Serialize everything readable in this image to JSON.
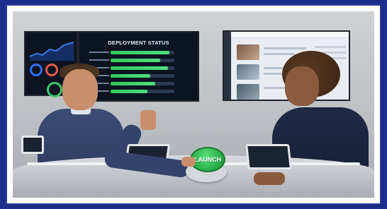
{
  "scene": {
    "deployment_status_title": "DEPLOYMENT STATUS",
    "launch_button_label": "LAUNCH",
    "deployment_progress": [
      0.92,
      0.78,
      0.9,
      0.62,
      0.7,
      0.58
    ],
    "colors": {
      "background": "#1f2f8e",
      "frame": "#ffffff",
      "launch_green": "#22a844",
      "progress_green": "#35c85a"
    }
  }
}
